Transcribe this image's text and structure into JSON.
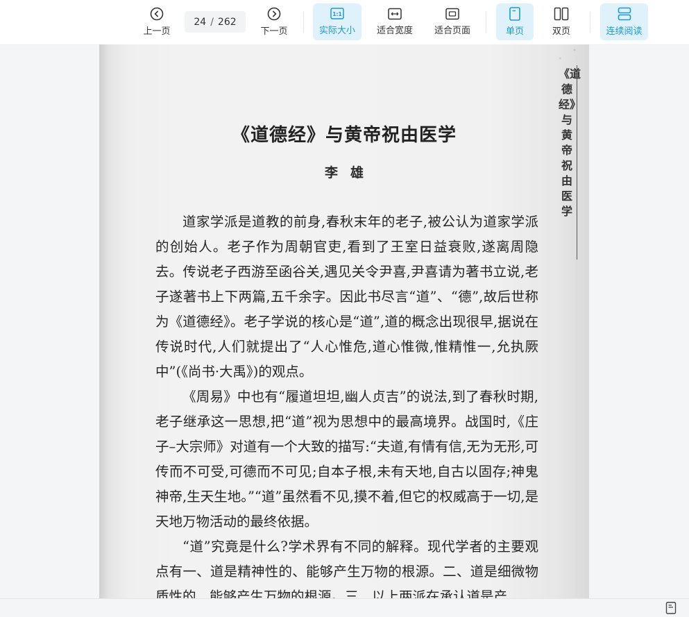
{
  "toolbar": {
    "prev_label": "上一页",
    "next_label": "下一页",
    "current_page": "24",
    "page_sep": "/",
    "total_pages": "262",
    "actual_size_label": "实际大小",
    "actual_size_glyph": "1:1",
    "fit_width_label": "适合宽度",
    "fit_page_label": "适合页面",
    "single_page_label": "单页",
    "double_page_label": "双页",
    "continuous_label": "连续阅读",
    "accent_color": "#1a9ad6",
    "active_bg": "#dff1fb"
  },
  "document": {
    "side_title": "《道德经》与黄帝祝由医学",
    "title": "《道德经》与黄帝祝由医学",
    "author": "李雄",
    "paragraphs": [
      "道家学派是道教的前身,春秋末年的老子,被公认为道家学派的创始人。老子作为周朝官吏,看到了王室日益衰败,遂离周隐去。传说老子西游至函谷关,遇见关令尹喜,尹喜请为著书立说,老子遂著书上下两篇,五千余字。因此书尽言“道”、“德”,故后世称为《道德经》。老子学说的核心是“道”,道的概念出现很早,据说在传说时代,人们就提出了“人心惟危,道心惟微,惟精惟一,允执厥中”(《尚书·大禹》)的观点。",
      "《周易》中也有“履道坦坦,幽人贞吉”的说法,到了春秋时期,老子继承这一思想,把“道”视为思想中的最高境界。战国时,《庄子–大宗师》对道有一个大致的描写:“夫道,有情有信,无为无形,可传而不可受,可德而不可见;自本子根,未有天地,自古以固存;神鬼神帝,生天生地。”“道”虽然看不见,摸不着,但它的权威高于一切,是天地万物活动的最终依据。",
      "“道”究竟是什么?学术界有不同的解释。现代学者的主要观点有一、道是精神性的、能够产生万物的根源。二、道是细微物质性的、能够产生万物的根源。三、以上两派在承认道是产"
    ]
  },
  "icons": {
    "prev": "chevron-left-circle-icon",
    "next": "chevron-right-circle-icon",
    "fit_width": "fit-width-icon",
    "fit_page": "fit-page-icon",
    "single": "single-page-icon",
    "double": "double-page-icon",
    "continuous": "continuous-scroll-icon",
    "status": "document-icon"
  }
}
